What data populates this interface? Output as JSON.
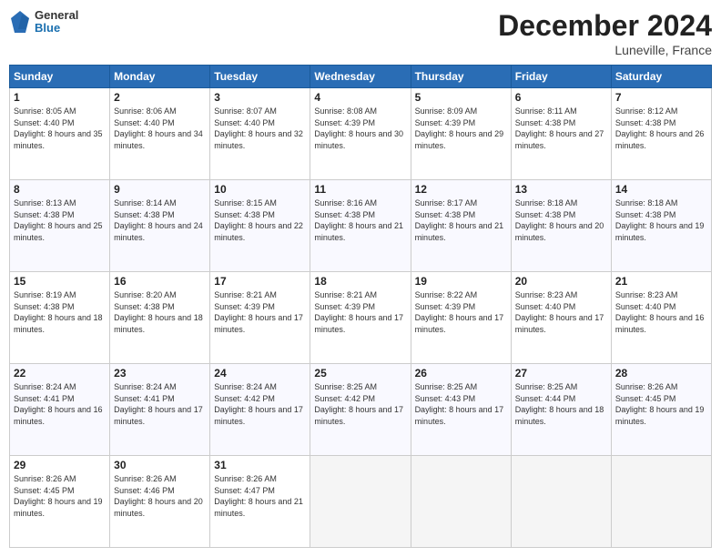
{
  "header": {
    "logo": {
      "general": "General",
      "blue": "Blue"
    },
    "title": "December 2024",
    "subtitle": "Luneville, France"
  },
  "days_of_week": [
    "Sunday",
    "Monday",
    "Tuesday",
    "Wednesday",
    "Thursday",
    "Friday",
    "Saturday"
  ],
  "weeks": [
    [
      {
        "day": 1,
        "sunrise": "8:05 AM",
        "sunset": "4:40 PM",
        "daylight": "8 hours and 35 minutes."
      },
      {
        "day": 2,
        "sunrise": "8:06 AM",
        "sunset": "4:40 PM",
        "daylight": "8 hours and 34 minutes."
      },
      {
        "day": 3,
        "sunrise": "8:07 AM",
        "sunset": "4:40 PM",
        "daylight": "8 hours and 32 minutes."
      },
      {
        "day": 4,
        "sunrise": "8:08 AM",
        "sunset": "4:39 PM",
        "daylight": "8 hours and 30 minutes."
      },
      {
        "day": 5,
        "sunrise": "8:09 AM",
        "sunset": "4:39 PM",
        "daylight": "8 hours and 29 minutes."
      },
      {
        "day": 6,
        "sunrise": "8:11 AM",
        "sunset": "4:38 PM",
        "daylight": "8 hours and 27 minutes."
      },
      {
        "day": 7,
        "sunrise": "8:12 AM",
        "sunset": "4:38 PM",
        "daylight": "8 hours and 26 minutes."
      }
    ],
    [
      {
        "day": 8,
        "sunrise": "8:13 AM",
        "sunset": "4:38 PM",
        "daylight": "8 hours and 25 minutes."
      },
      {
        "day": 9,
        "sunrise": "8:14 AM",
        "sunset": "4:38 PM",
        "daylight": "8 hours and 24 minutes."
      },
      {
        "day": 10,
        "sunrise": "8:15 AM",
        "sunset": "4:38 PM",
        "daylight": "8 hours and 22 minutes."
      },
      {
        "day": 11,
        "sunrise": "8:16 AM",
        "sunset": "4:38 PM",
        "daylight": "8 hours and 21 minutes."
      },
      {
        "day": 12,
        "sunrise": "8:17 AM",
        "sunset": "4:38 PM",
        "daylight": "8 hours and 21 minutes."
      },
      {
        "day": 13,
        "sunrise": "8:18 AM",
        "sunset": "4:38 PM",
        "daylight": "8 hours and 20 minutes."
      },
      {
        "day": 14,
        "sunrise": "8:18 AM",
        "sunset": "4:38 PM",
        "daylight": "8 hours and 19 minutes."
      }
    ],
    [
      {
        "day": 15,
        "sunrise": "8:19 AM",
        "sunset": "4:38 PM",
        "daylight": "8 hours and 18 minutes."
      },
      {
        "day": 16,
        "sunrise": "8:20 AM",
        "sunset": "4:38 PM",
        "daylight": "8 hours and 18 minutes."
      },
      {
        "day": 17,
        "sunrise": "8:21 AM",
        "sunset": "4:39 PM",
        "daylight": "8 hours and 17 minutes."
      },
      {
        "day": 18,
        "sunrise": "8:21 AM",
        "sunset": "4:39 PM",
        "daylight": "8 hours and 17 minutes."
      },
      {
        "day": 19,
        "sunrise": "8:22 AM",
        "sunset": "4:39 PM",
        "daylight": "8 hours and 17 minutes."
      },
      {
        "day": 20,
        "sunrise": "8:23 AM",
        "sunset": "4:40 PM",
        "daylight": "8 hours and 17 minutes."
      },
      {
        "day": 21,
        "sunrise": "8:23 AM",
        "sunset": "4:40 PM",
        "daylight": "8 hours and 16 minutes."
      }
    ],
    [
      {
        "day": 22,
        "sunrise": "8:24 AM",
        "sunset": "4:41 PM",
        "daylight": "8 hours and 16 minutes."
      },
      {
        "day": 23,
        "sunrise": "8:24 AM",
        "sunset": "4:41 PM",
        "daylight": "8 hours and 17 minutes."
      },
      {
        "day": 24,
        "sunrise": "8:24 AM",
        "sunset": "4:42 PM",
        "daylight": "8 hours and 17 minutes."
      },
      {
        "day": 25,
        "sunrise": "8:25 AM",
        "sunset": "4:42 PM",
        "daylight": "8 hours and 17 minutes."
      },
      {
        "day": 26,
        "sunrise": "8:25 AM",
        "sunset": "4:43 PM",
        "daylight": "8 hours and 17 minutes."
      },
      {
        "day": 27,
        "sunrise": "8:25 AM",
        "sunset": "4:44 PM",
        "daylight": "8 hours and 18 minutes."
      },
      {
        "day": 28,
        "sunrise": "8:26 AM",
        "sunset": "4:45 PM",
        "daylight": "8 hours and 19 minutes."
      }
    ],
    [
      {
        "day": 29,
        "sunrise": "8:26 AM",
        "sunset": "4:45 PM",
        "daylight": "8 hours and 19 minutes."
      },
      {
        "day": 30,
        "sunrise": "8:26 AM",
        "sunset": "4:46 PM",
        "daylight": "8 hours and 20 minutes."
      },
      {
        "day": 31,
        "sunrise": "8:26 AM",
        "sunset": "4:47 PM",
        "daylight": "8 hours and 21 minutes."
      },
      null,
      null,
      null,
      null
    ]
  ]
}
